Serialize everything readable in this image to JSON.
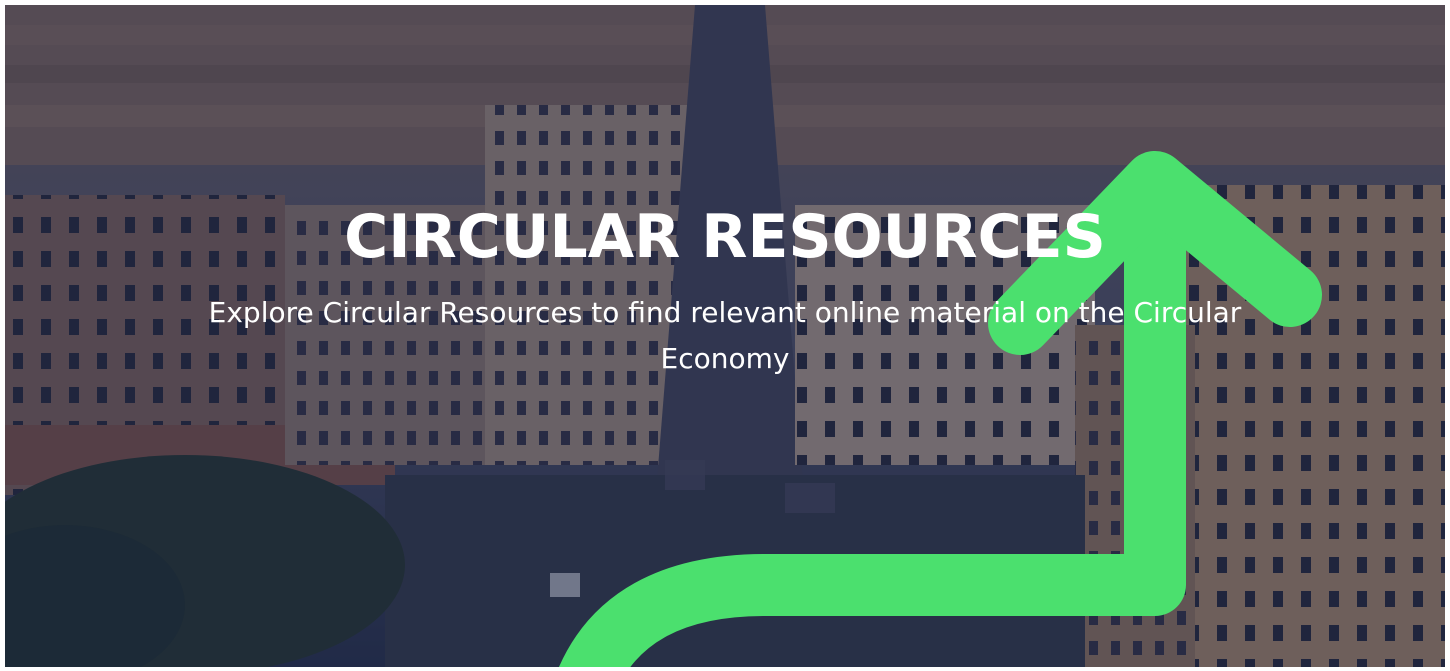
{
  "hero": {
    "title": "CIRCULAR RESOURCES",
    "subtitle": "Explore Circular Resources to find relevant online material on the Circular Economy",
    "accent_color": "#4be06e",
    "overlay_color": "#1e2a5a",
    "background_description_icon": "city-aerial-image"
  }
}
